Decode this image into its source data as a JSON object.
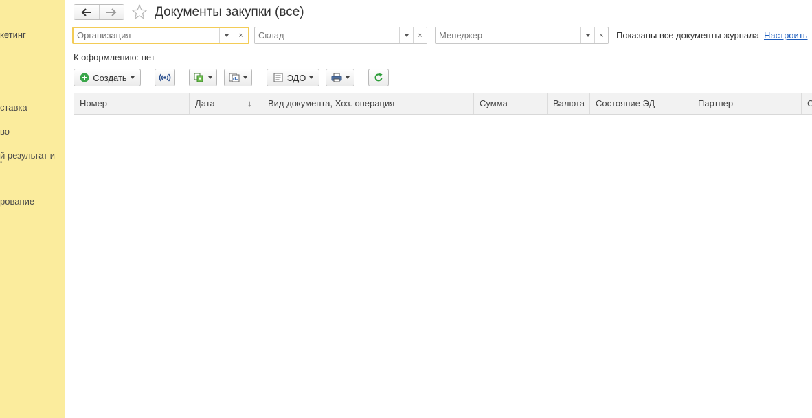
{
  "sidebar": {
    "items": [
      {
        "label": "кетинг"
      },
      {
        "label": "ставка"
      },
      {
        "label": "во"
      },
      {
        "label": "й результат и"
      },
      {
        "label": "-"
      },
      {
        "label": "рование"
      }
    ]
  },
  "header": {
    "title": "Документы закупки (все)"
  },
  "filters": {
    "organization": {
      "placeholder": "Организация",
      "value": ""
    },
    "warehouse": {
      "placeholder": "Склад",
      "value": ""
    },
    "manager": {
      "placeholder": "Менеджер",
      "value": ""
    },
    "clear_glyph": "×"
  },
  "journal": {
    "status_text": "Показаны все документы журнала",
    "configure_link": "Настроить",
    "pending_text": "К оформлению: нет"
  },
  "toolbar": {
    "create_label": "Создать",
    "edo_label": "ЭДО"
  },
  "table": {
    "columns": [
      {
        "label": "Номер"
      },
      {
        "label": "Дата",
        "sort": "↓"
      },
      {
        "label": "Вид документа, Хоз. операция"
      },
      {
        "label": "Сумма"
      },
      {
        "label": "Валюта"
      },
      {
        "label": "Состояние ЭД"
      },
      {
        "label": "Партнер"
      },
      {
        "label": "С"
      }
    ],
    "rows": []
  },
  "colors": {
    "sidebar_bg": "#fbec9d",
    "active_field_border": "#f3cc57",
    "link": "#1f5ebd",
    "create_icon": "#3aa64a",
    "refresh_icon": "#2f9e3b"
  }
}
